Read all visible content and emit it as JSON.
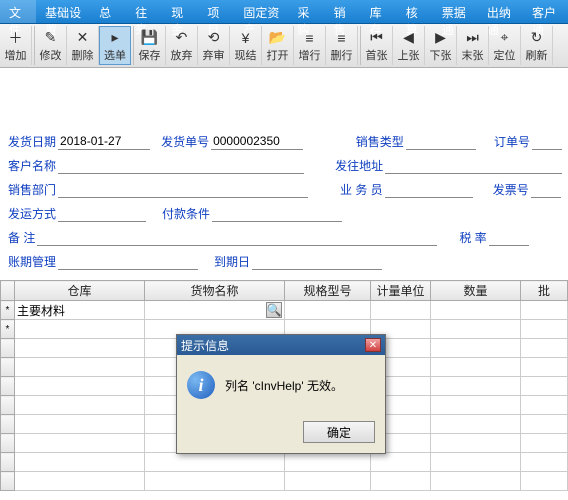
{
  "menu": [
    "文件",
    "基础设置",
    "总账",
    "往来",
    "现金",
    "项目",
    "固定资产",
    "采购",
    "销售",
    "库存",
    "核算",
    "票据通",
    "出纳通",
    "客户通"
  ],
  "toolbar": [
    {
      "label": "增加",
      "icon": "＋"
    },
    {
      "label": "修改",
      "icon": "✎"
    },
    {
      "label": "删除",
      "icon": "✕"
    },
    {
      "label": "选单",
      "icon": "▸",
      "sel": true
    },
    {
      "label": "保存",
      "icon": "💾"
    },
    {
      "label": "放弃",
      "icon": "↶"
    },
    {
      "label": "弃审",
      "icon": "⟲"
    },
    {
      "label": "现结",
      "icon": "¥"
    },
    {
      "label": "打开",
      "icon": "📂"
    },
    {
      "label": "增行",
      "icon": "≡"
    },
    {
      "label": "删行",
      "icon": "≡"
    },
    {
      "label": "首张",
      "icon": "⏮"
    },
    {
      "label": "上张",
      "icon": "◀"
    },
    {
      "label": "下张",
      "icon": "▶"
    },
    {
      "label": "末张",
      "icon": "⏭"
    },
    {
      "label": "定位",
      "icon": "⌖"
    },
    {
      "label": "刷新",
      "icon": "↻"
    }
  ],
  "form": {
    "ship_date_label": "发货日期",
    "ship_date": "2018-01-27",
    "ship_no_label": "发货单号",
    "ship_no": "0000002350",
    "sale_type_label": "销售类型",
    "sale_type": "",
    "order_no_label": "订单号",
    "cust_name_label": "客户名称",
    "cust_name": "",
    "ship_addr_label": "发往地址",
    "ship_addr": "",
    "sale_dept_label": "销售部门",
    "sale_dept": "",
    "salesman_label": "业 务 员",
    "salesman": "",
    "invoice_no_label": "发票号",
    "ship_method_label": "发运方式",
    "ship_method": "",
    "pay_terms_label": "付款条件",
    "pay_terms": "",
    "remark_label": "备    注",
    "remark": "",
    "tax_rate_label": "税  率",
    "tax_rate": "",
    "credit_label": "账期管理",
    "credit": "",
    "due_date_label": "到期日",
    "due_date": ""
  },
  "grid": {
    "columns": [
      "仓库",
      "货物名称",
      "规格型号",
      "计量单位",
      "数量",
      "批"
    ],
    "row0_warehouse": "主要材料"
  },
  "dialog": {
    "title": "提示信息",
    "message": "列名 'cInvHelp' 无效。",
    "ok": "确定"
  }
}
